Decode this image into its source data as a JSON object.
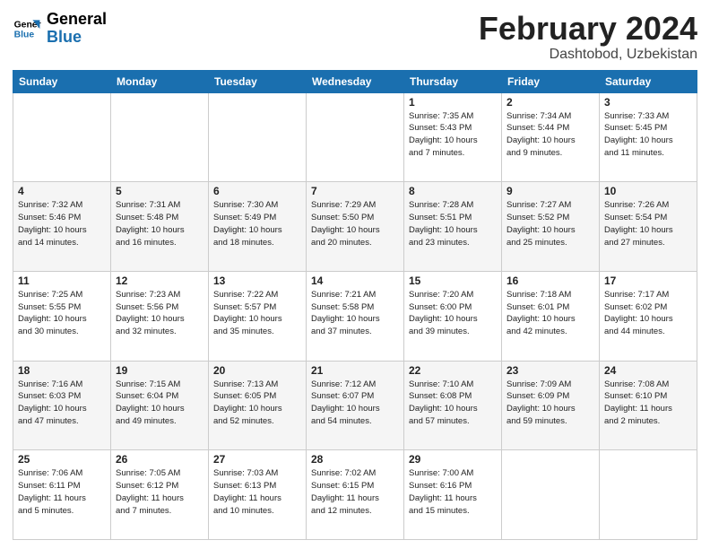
{
  "logo": {
    "line1": "General",
    "line2": "Blue"
  },
  "header": {
    "month": "February 2024",
    "location": "Dashtobod, Uzbekistan"
  },
  "weekdays": [
    "Sunday",
    "Monday",
    "Tuesday",
    "Wednesday",
    "Thursday",
    "Friday",
    "Saturday"
  ],
  "weeks": [
    [
      {
        "day": "",
        "info": ""
      },
      {
        "day": "",
        "info": ""
      },
      {
        "day": "",
        "info": ""
      },
      {
        "day": "",
        "info": ""
      },
      {
        "day": "1",
        "info": "Sunrise: 7:35 AM\nSunset: 5:43 PM\nDaylight: 10 hours\nand 7 minutes."
      },
      {
        "day": "2",
        "info": "Sunrise: 7:34 AM\nSunset: 5:44 PM\nDaylight: 10 hours\nand 9 minutes."
      },
      {
        "day": "3",
        "info": "Sunrise: 7:33 AM\nSunset: 5:45 PM\nDaylight: 10 hours\nand 11 minutes."
      }
    ],
    [
      {
        "day": "4",
        "info": "Sunrise: 7:32 AM\nSunset: 5:46 PM\nDaylight: 10 hours\nand 14 minutes."
      },
      {
        "day": "5",
        "info": "Sunrise: 7:31 AM\nSunset: 5:48 PM\nDaylight: 10 hours\nand 16 minutes."
      },
      {
        "day": "6",
        "info": "Sunrise: 7:30 AM\nSunset: 5:49 PM\nDaylight: 10 hours\nand 18 minutes."
      },
      {
        "day": "7",
        "info": "Sunrise: 7:29 AM\nSunset: 5:50 PM\nDaylight: 10 hours\nand 20 minutes."
      },
      {
        "day": "8",
        "info": "Sunrise: 7:28 AM\nSunset: 5:51 PM\nDaylight: 10 hours\nand 23 minutes."
      },
      {
        "day": "9",
        "info": "Sunrise: 7:27 AM\nSunset: 5:52 PM\nDaylight: 10 hours\nand 25 minutes."
      },
      {
        "day": "10",
        "info": "Sunrise: 7:26 AM\nSunset: 5:54 PM\nDaylight: 10 hours\nand 27 minutes."
      }
    ],
    [
      {
        "day": "11",
        "info": "Sunrise: 7:25 AM\nSunset: 5:55 PM\nDaylight: 10 hours\nand 30 minutes."
      },
      {
        "day": "12",
        "info": "Sunrise: 7:23 AM\nSunset: 5:56 PM\nDaylight: 10 hours\nand 32 minutes."
      },
      {
        "day": "13",
        "info": "Sunrise: 7:22 AM\nSunset: 5:57 PM\nDaylight: 10 hours\nand 35 minutes."
      },
      {
        "day": "14",
        "info": "Sunrise: 7:21 AM\nSunset: 5:58 PM\nDaylight: 10 hours\nand 37 minutes."
      },
      {
        "day": "15",
        "info": "Sunrise: 7:20 AM\nSunset: 6:00 PM\nDaylight: 10 hours\nand 39 minutes."
      },
      {
        "day": "16",
        "info": "Sunrise: 7:18 AM\nSunset: 6:01 PM\nDaylight: 10 hours\nand 42 minutes."
      },
      {
        "day": "17",
        "info": "Sunrise: 7:17 AM\nSunset: 6:02 PM\nDaylight: 10 hours\nand 44 minutes."
      }
    ],
    [
      {
        "day": "18",
        "info": "Sunrise: 7:16 AM\nSunset: 6:03 PM\nDaylight: 10 hours\nand 47 minutes."
      },
      {
        "day": "19",
        "info": "Sunrise: 7:15 AM\nSunset: 6:04 PM\nDaylight: 10 hours\nand 49 minutes."
      },
      {
        "day": "20",
        "info": "Sunrise: 7:13 AM\nSunset: 6:05 PM\nDaylight: 10 hours\nand 52 minutes."
      },
      {
        "day": "21",
        "info": "Sunrise: 7:12 AM\nSunset: 6:07 PM\nDaylight: 10 hours\nand 54 minutes."
      },
      {
        "day": "22",
        "info": "Sunrise: 7:10 AM\nSunset: 6:08 PM\nDaylight: 10 hours\nand 57 minutes."
      },
      {
        "day": "23",
        "info": "Sunrise: 7:09 AM\nSunset: 6:09 PM\nDaylight: 10 hours\nand 59 minutes."
      },
      {
        "day": "24",
        "info": "Sunrise: 7:08 AM\nSunset: 6:10 PM\nDaylight: 11 hours\nand 2 minutes."
      }
    ],
    [
      {
        "day": "25",
        "info": "Sunrise: 7:06 AM\nSunset: 6:11 PM\nDaylight: 11 hours\nand 5 minutes."
      },
      {
        "day": "26",
        "info": "Sunrise: 7:05 AM\nSunset: 6:12 PM\nDaylight: 11 hours\nand 7 minutes."
      },
      {
        "day": "27",
        "info": "Sunrise: 7:03 AM\nSunset: 6:13 PM\nDaylight: 11 hours\nand 10 minutes."
      },
      {
        "day": "28",
        "info": "Sunrise: 7:02 AM\nSunset: 6:15 PM\nDaylight: 11 hours\nand 12 minutes."
      },
      {
        "day": "29",
        "info": "Sunrise: 7:00 AM\nSunset: 6:16 PM\nDaylight: 11 hours\nand 15 minutes."
      },
      {
        "day": "",
        "info": ""
      },
      {
        "day": "",
        "info": ""
      }
    ]
  ]
}
